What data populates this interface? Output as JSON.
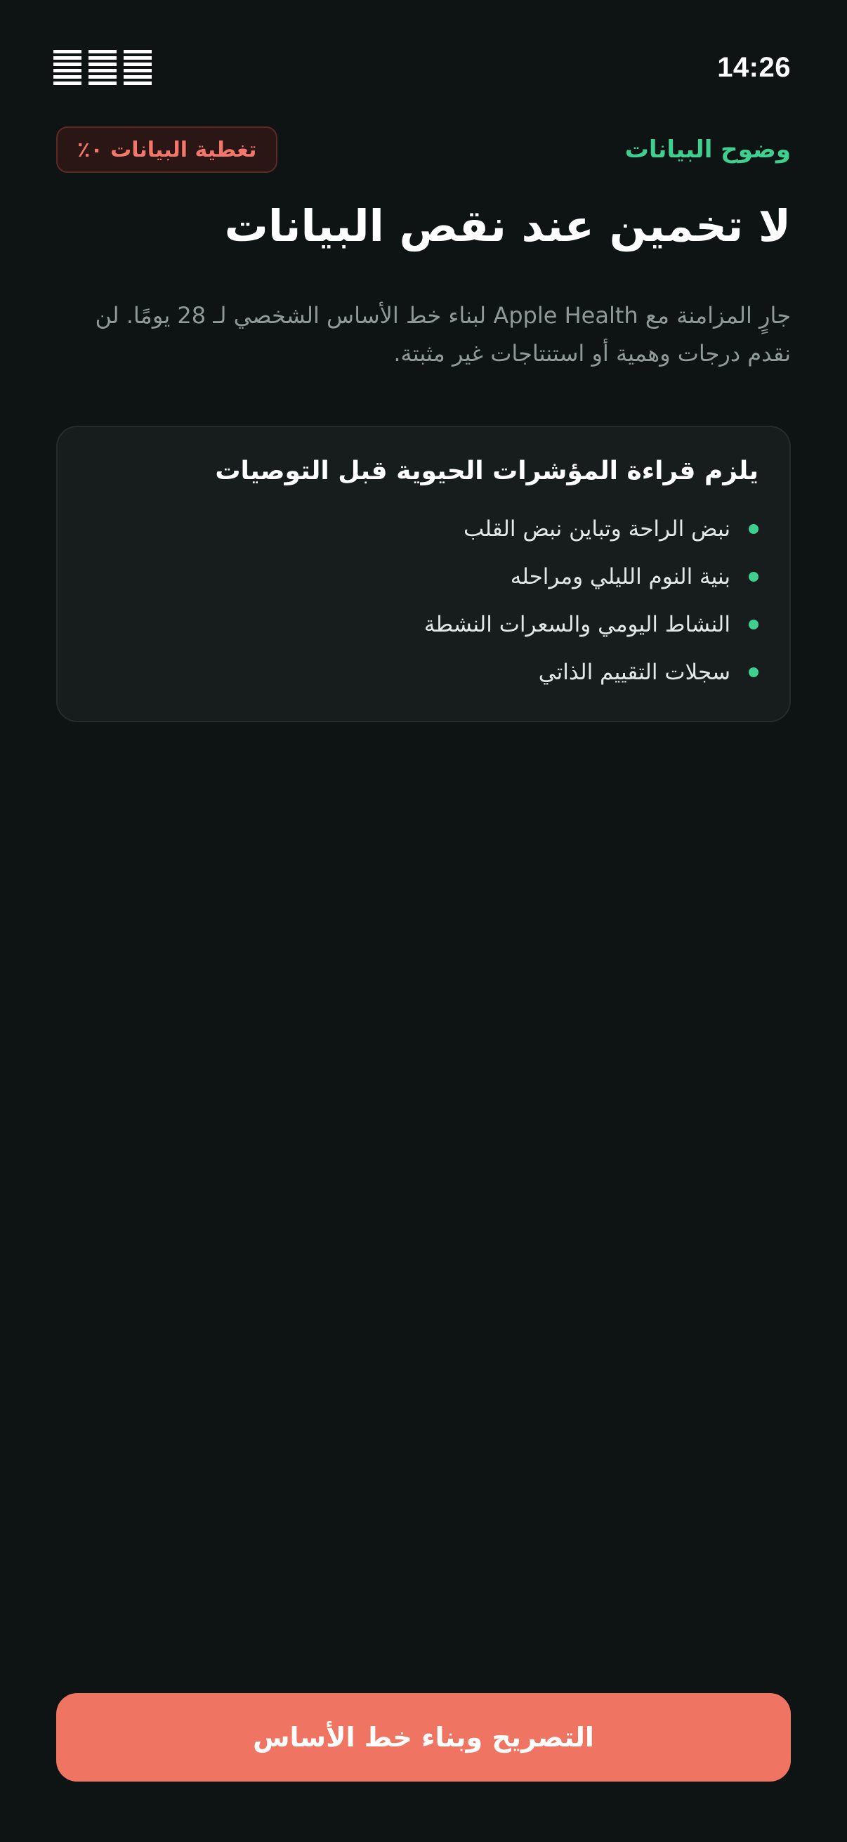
{
  "status_bar": {
    "time": "14:26",
    "icons": [
      "signal-icon",
      "wifi-icon",
      "battery-icon"
    ]
  },
  "header": {
    "section_label": "وضوح البيانات",
    "coverage_badge": "تغطية البيانات ٠٪"
  },
  "main": {
    "title": "لا تخمين عند نقص البيانات",
    "description": "جارٍ المزامنة مع Apple Health لبناء خط الأساس الشخصي لـ 28 يومًا. لن نقدم درجات وهمية أو استنتاجات غير مثبتة."
  },
  "requirements_card": {
    "title": "يلزم قراءة المؤشرات الحيوية قبل التوصيات",
    "items": [
      "نبض الراحة وتباين نبض القلب",
      "بنية النوم الليلي ومراحله",
      "النشاط اليومي والسعرات النشطة",
      "سجلات التقييم الذاتي"
    ]
  },
  "actions": {
    "primary_label": "التصريح وبناء خط الأساس"
  },
  "colors": {
    "background": "#0d1413",
    "accent_green": "#3fcf8e",
    "warning_red": "#f2776a",
    "primary_button": "#f07462"
  }
}
